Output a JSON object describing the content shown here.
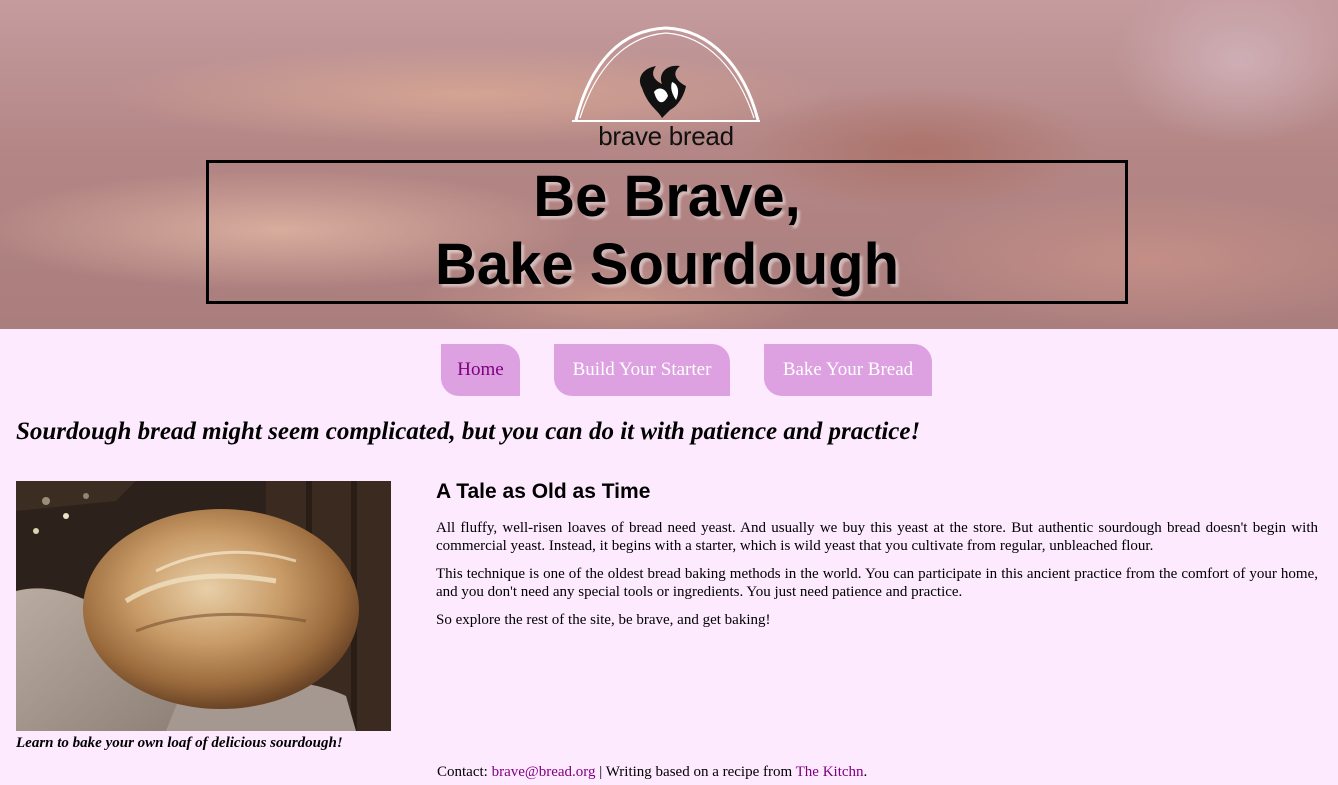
{
  "brand": {
    "logo_text": "brave bread"
  },
  "hero": {
    "headline_line1": "Be Brave,",
    "headline_line2": "Bake Sourdough"
  },
  "nav": {
    "items": [
      {
        "label": "Home",
        "active": true
      },
      {
        "label": "Build Your Starter",
        "active": false
      },
      {
        "label": "Bake Your Bread",
        "active": false
      }
    ]
  },
  "tagline": "Sourdough bread might seem complicated, but you can do it with patience and practice!",
  "figure": {
    "icon": "sourdough-loaf-photo",
    "caption": "Learn to bake your own loaf of delicious sourdough!"
  },
  "article": {
    "heading": "A Tale as Old as Time",
    "paragraphs": [
      "All fluffy, well-risen loaves of bread need yeast. And usually we buy this yeast at the store. But authentic sourdough bread doesn't begin with commercial yeast. Instead, it begins with a starter, which is wild yeast that you cultivate from regular, unbleached flour.",
      "This technique is one of the oldest bread baking methods in the world. You can participate in this ancient practice from the comfort of your home, and you don't need any special tools or ingredients. You just need patience and practice.",
      "So explore the rest of the site, be brave, and get baking!"
    ]
  },
  "footer": {
    "contact_label": "Contact: ",
    "email": "brave@bread.org",
    "separator": " | Writing based on a recipe from ",
    "source_link": "The Kitchn",
    "end": "."
  },
  "colors": {
    "background": "#feeaff",
    "nav_bg": "#dda0e0",
    "link": "#800080"
  }
}
